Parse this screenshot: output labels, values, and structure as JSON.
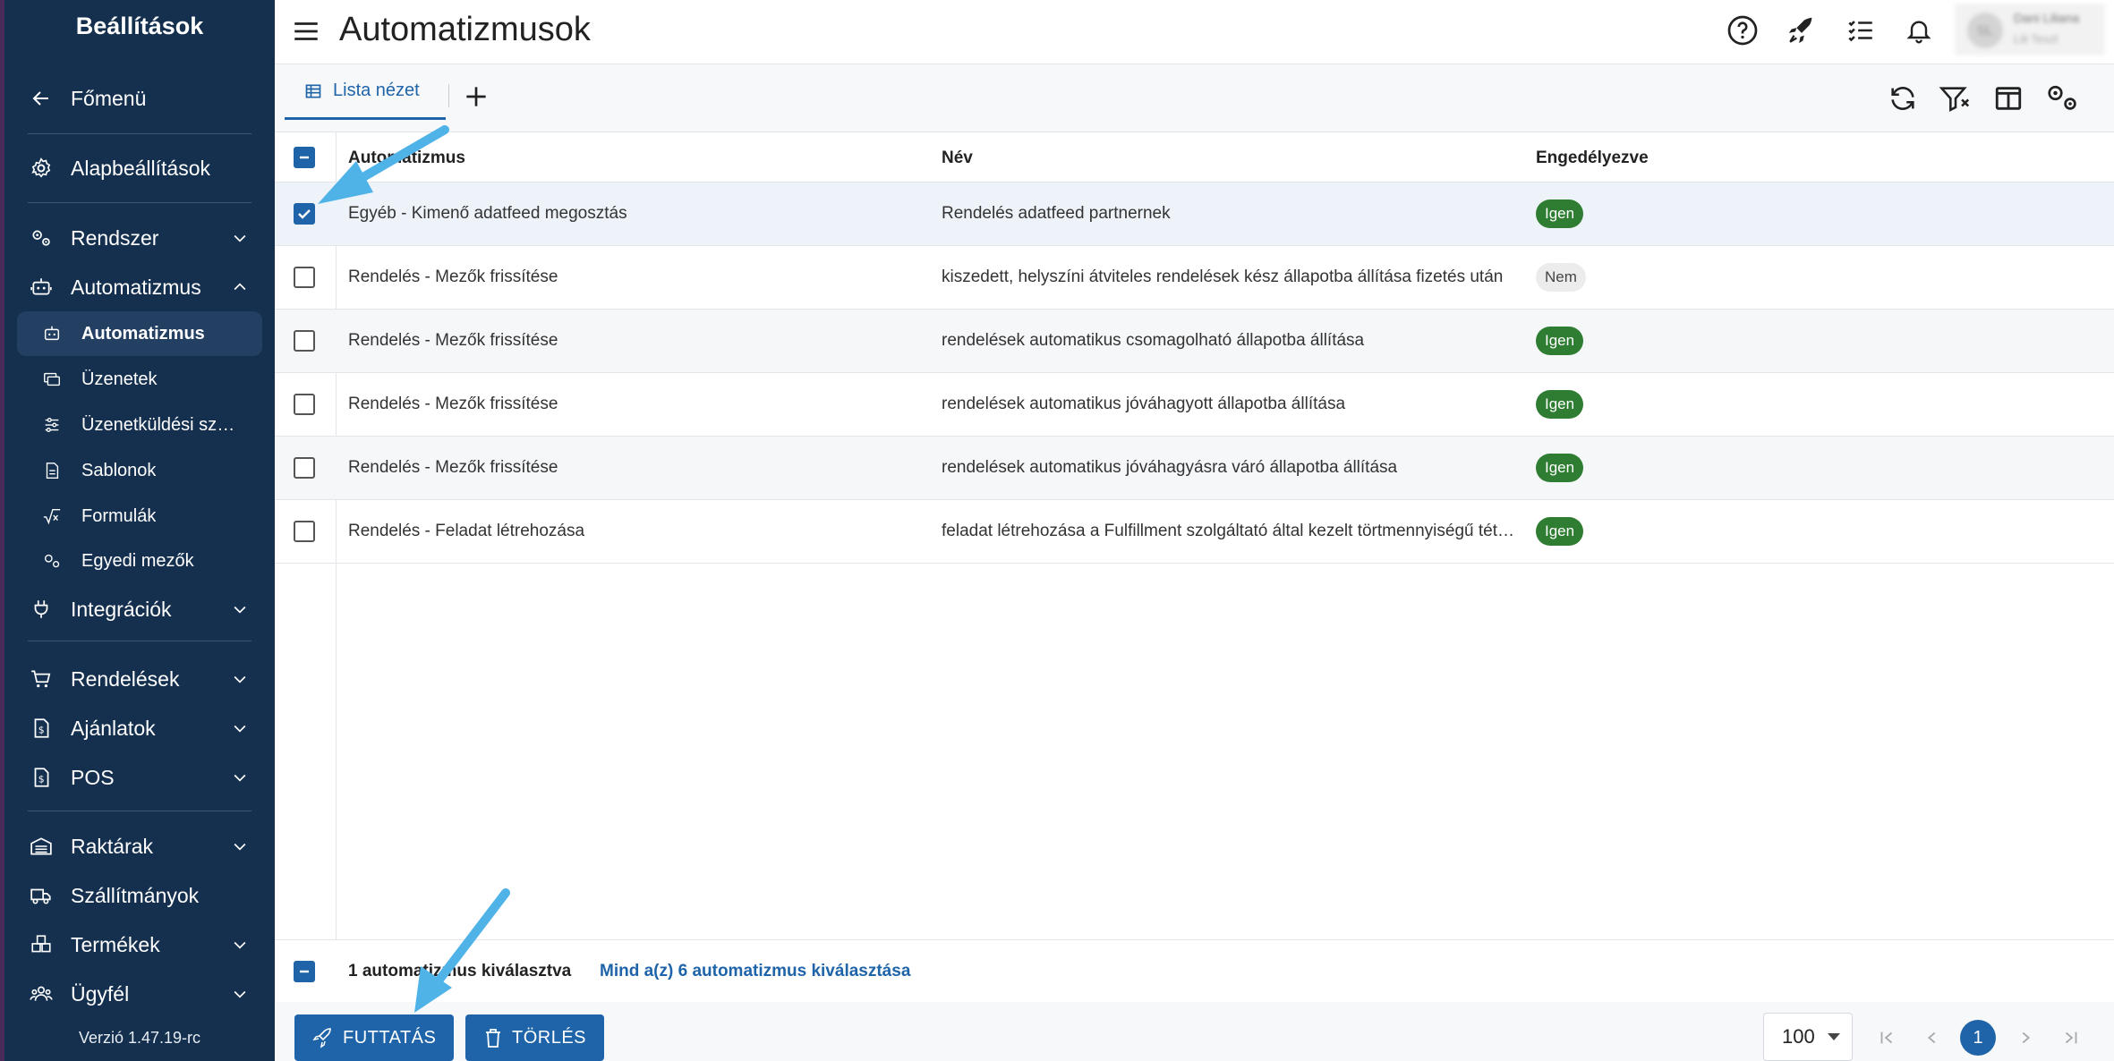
{
  "sidebar": {
    "title": "Beállítások",
    "back": "Főmenü",
    "basic": "Alapbeállítások",
    "items": [
      {
        "label": "Rendszer"
      },
      {
        "label": "Automatizmus"
      },
      {
        "label": "Integrációk"
      },
      {
        "label": "Rendelések"
      },
      {
        "label": "Ajánlatok"
      },
      {
        "label": "POS"
      },
      {
        "label": "Raktárak"
      },
      {
        "label": "Szállítmányok"
      },
      {
        "label": "Termékek"
      },
      {
        "label": "Ügyfél"
      }
    ],
    "sub": [
      {
        "label": "Automatizmus"
      },
      {
        "label": "Üzenetek"
      },
      {
        "label": "Üzenetküldési szabályok"
      },
      {
        "label": "Sablonok"
      },
      {
        "label": "Formulák"
      },
      {
        "label": "Egyedi mezők"
      }
    ],
    "version": "Verzió 1.47.19-rc"
  },
  "header": {
    "title": "Automatizmusok",
    "user_initials": "SL",
    "user_name": "Dani Liliana",
    "user_sub": "Lili Teszt"
  },
  "toolbar": {
    "tab_label": "Lista nézet"
  },
  "table": {
    "columns": [
      "Automatizmus",
      "Név",
      "Engedélyezve"
    ],
    "rows": [
      {
        "automation": "Egyéb - Kimenő adatfeed megosztás",
        "name": "Rendelés adatfeed partnernek",
        "enabled": "Igen"
      },
      {
        "automation": "Rendelés - Mezők frissítése",
        "name": "kiszedett, helyszíni átviteles rendelések kész állapotba állítása fizetés után",
        "enabled": "Nem"
      },
      {
        "automation": "Rendelés - Mezők frissítése",
        "name": "rendelések automatikus csomagolható állapotba állítása",
        "enabled": "Igen"
      },
      {
        "automation": "Rendelés - Mezők frissítése",
        "name": "rendelések automatikus jóváhagyott állapotba állítása",
        "enabled": "Igen"
      },
      {
        "automation": "Rendelés - Mezők frissítése",
        "name": "rendelések automatikus jóváhagyásra váró állapotba állítása",
        "enabled": "Igen"
      },
      {
        "automation": "Rendelés - Feladat létrehozása",
        "name": "feladat létrehozása a Fulfillment szolgáltató által kezelt törtmennyiségű tételekre",
        "enabled": "Igen"
      }
    ]
  },
  "selection": {
    "text": "1 automatizmus kiválasztva",
    "select_all": "Mind a(z) 6 automatizmus kiválasztása"
  },
  "actions": {
    "run": "FUTTATÁS",
    "delete": "TÖRLÉS"
  },
  "pagination": {
    "page_size": "100",
    "current_page": "1"
  },
  "colors": {
    "sidebar_bg": "#15304f",
    "accent": "#1f63a8",
    "badge_yes": "#2e7d32",
    "arrow": "#4fb3e8"
  }
}
